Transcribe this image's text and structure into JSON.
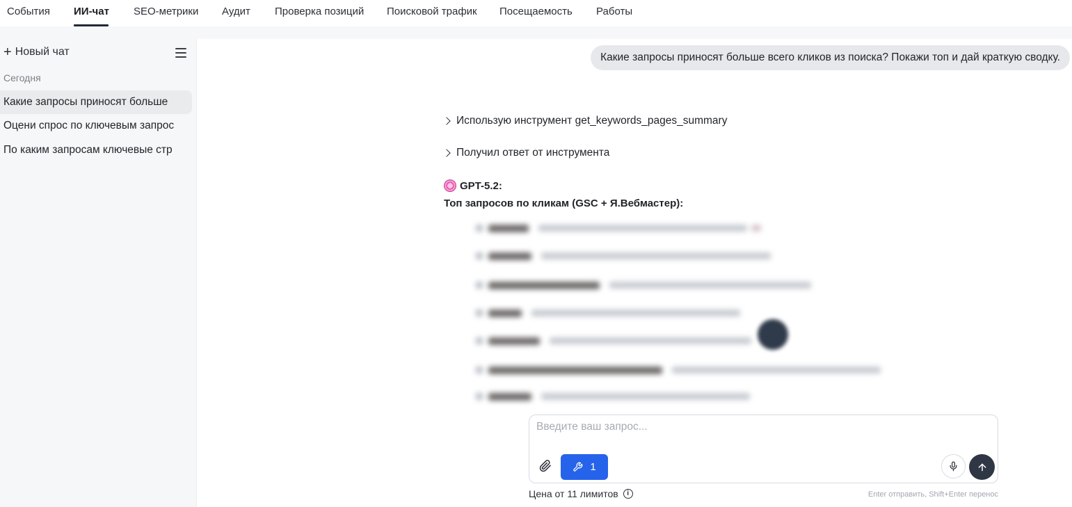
{
  "nav": {
    "tabs": [
      {
        "label": "События"
      },
      {
        "label": "ИИ-чат",
        "active": true
      },
      {
        "label": "SEO-метрики"
      },
      {
        "label": "Аудит"
      },
      {
        "label": "Проверка позиций"
      },
      {
        "label": "Поисковой трафик"
      },
      {
        "label": "Посещаемость"
      },
      {
        "label": "Работы"
      }
    ]
  },
  "sidebar": {
    "new_chat_label": "Новый чат",
    "section_today": "Сегодня",
    "history": [
      {
        "label": "Какие запросы приносят больше",
        "active": true
      },
      {
        "label": "Оцени спрос по ключевым запрос"
      },
      {
        "label": "По каким запросам ключевые стр"
      }
    ]
  },
  "chat": {
    "user_message": "Какие запросы приносят больше всего кликов из поиска? Покажи топ и дай краткую сводку.",
    "tool_used": "Использую инструмент get_keywords_pages_summary",
    "tool_response": "Получил ответ от инструмента",
    "model_name": "GPT-5.2:",
    "summary_title": "Топ запросов по кликам (GSC + Я.Вебмастер):"
  },
  "composer": {
    "placeholder": "Введите ваш запрос...",
    "tools_count": "1",
    "price_label": "Цена от 11 лимитов",
    "hint": "Enter отправить, Shift+Enter перенос"
  },
  "colors": {
    "accent": "#2563eb",
    "send_button": "#2f3744",
    "bubble": "#e6e8eb",
    "sidebar_bg": "#f6f7f8"
  }
}
